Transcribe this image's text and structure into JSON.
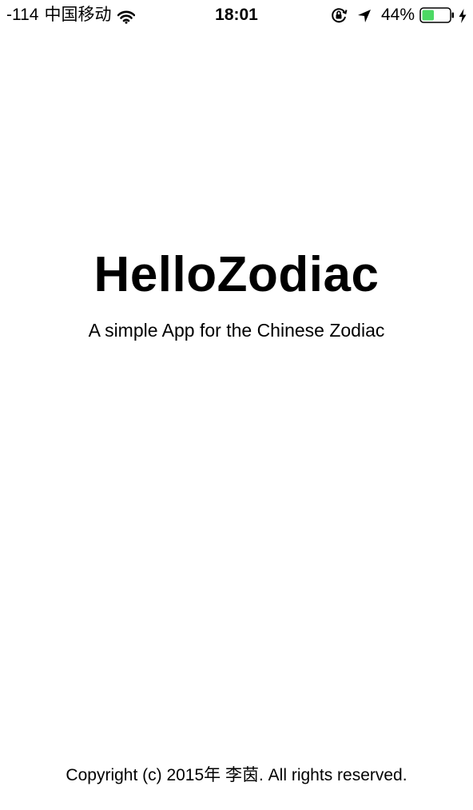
{
  "status_bar": {
    "signal": "-114",
    "carrier": "中国移动",
    "time": "18:01",
    "battery_percent": "44%",
    "battery_level": 0.44,
    "battery_color": "#4cd964",
    "icons": [
      "wifi-icon",
      "rotation-lock-icon",
      "location-arrow-icon",
      "battery-icon",
      "charging-bolt-icon"
    ]
  },
  "launch": {
    "title": "HelloZodiac",
    "subtitle": "A simple App for the Chinese Zodiac",
    "copyright": "Copyright (c) 2015年 李茵. All rights reserved."
  }
}
